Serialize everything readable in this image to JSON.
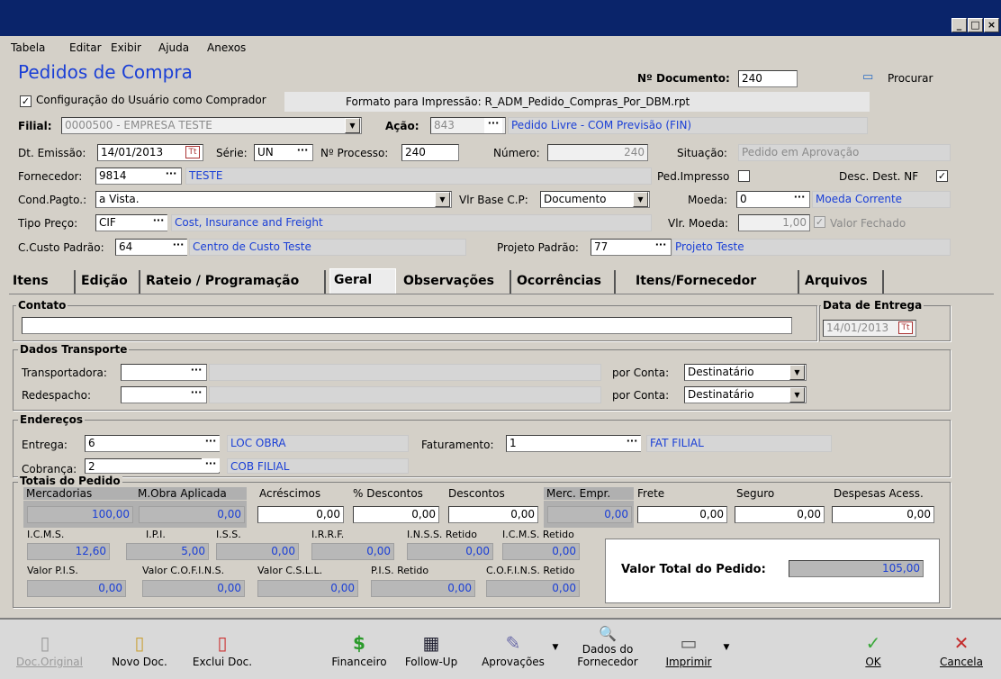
{
  "window": {
    "controls": [
      "_",
      "□",
      "×"
    ]
  },
  "menu": [
    "Tabela",
    "Editar",
    "Exibir",
    "Ajuda",
    "Anexos"
  ],
  "header": {
    "title": "Pedidos de Compra",
    "doc_label": "Nº Documento:",
    "doc_value": "240",
    "search_label": "Procurar"
  },
  "config": {
    "checkbox_label": "Configuração do Usuário como Comprador",
    "checked": true,
    "format_label": "Formato para Impressão: R_ADM_Pedido_Compras_Por_DBM.rpt"
  },
  "form": {
    "filial_label": "Filial:",
    "filial_value": "0000500 - EMPRESA TESTE",
    "acao_label": "Ação:",
    "acao_code": "843",
    "acao_desc": "Pedido Livre - COM Previsão (FIN)",
    "emissao_label": "Dt. Emissão:",
    "emissao_value": "14/01/2013",
    "serie_label": "Série:",
    "serie_value": "UN",
    "processo_label": "Nº Processo:",
    "processo_value": "240",
    "numero_label": "Número:",
    "numero_value": "240",
    "situacao_label": "Situação:",
    "situacao_value": "Pedido em Aprovação",
    "fornecedor_label": "Fornecedor:",
    "fornecedor_code": "9814",
    "fornecedor_name": "TESTE",
    "ped_impresso_label": "Ped.Impresso",
    "desc_dest_label": "Desc. Dest. NF",
    "cond_label": "Cond.Pagto.:",
    "cond_value": "a Vista.",
    "vlr_base_label": "Vlr Base C.P:",
    "vlr_base_value": "Documento",
    "moeda_label": "Moeda:",
    "moeda_code": "0",
    "moeda_desc": "Moeda Corrente",
    "tipo_preco_label": "Tipo Preço:",
    "tipo_preco_code": "CIF",
    "tipo_preco_desc": "Cost, Insurance and Freight",
    "vlr_moeda_label": "Vlr. Moeda:",
    "vlr_moeda_value": "1,00",
    "valor_fechado_label": "Valor Fechado",
    "ccusto_label": "C.Custo Padrão:",
    "ccusto_code": "64",
    "ccusto_desc": "Centro de Custo Teste",
    "projeto_label": "Projeto Padrão:",
    "projeto_code": "77",
    "projeto_desc": "Projeto Teste"
  },
  "tabs": [
    "Itens",
    "Edição",
    "Rateio / Programação",
    "Geral",
    "Observações",
    "Ocorrências",
    "Itens/Fornecedor",
    "Arquivos"
  ],
  "geral": {
    "contato_title": "Contato",
    "entrega_title": "Data de Entrega",
    "entrega_value": "14/01/2013",
    "transporte_title": "Dados Transporte",
    "transportadora_label": "Transportadora:",
    "redespacho_label": "Redespacho:",
    "por_conta_label": "por Conta:",
    "por_conta_1": "Destinatário",
    "por_conta_2": "Destinatário",
    "enderecos_title": "Endereços",
    "entrega_label": "Entrega:",
    "entrega_code": "6",
    "entrega_desc": "LOC OBRA",
    "faturamento_label": "Faturamento:",
    "faturamento_code": "1",
    "faturamento_desc": "FAT FILIAL",
    "cobranca_label": "Cobrança:",
    "cobranca_code": "2",
    "cobranca_desc": "COB FILIAL"
  },
  "totais": {
    "title": "Totais do Pedido",
    "row1_labels": [
      "Mercadorias",
      "M.Obra Aplicada",
      "Acréscimos",
      "% Descontos",
      "Descontos",
      "Merc. Empr.",
      "Frete",
      "Seguro",
      "Despesas Acess."
    ],
    "row1_values": [
      "100,00",
      "0,00",
      "0,00",
      "0,00",
      "0,00",
      "0,00",
      "0,00",
      "0,00",
      "0,00"
    ],
    "row2_labels": [
      "I.C.M.S.",
      "I.P.I.",
      "I.S.S.",
      "I.R.R.F.",
      "I.N.S.S. Retido",
      "I.C.M.S. Retido"
    ],
    "row2_values": [
      "12,60",
      "5,00",
      "0,00",
      "0,00",
      "0,00",
      "0,00"
    ],
    "row3_labels": [
      "Valor P.I.S.",
      "Valor C.O.F.I.N.S.",
      "Valor C.S.L.L.",
      "P.I.S. Retido",
      "C.O.F.I.N.S. Retido"
    ],
    "row3_values": [
      "0,00",
      "0,00",
      "0,00",
      "0,00",
      "0,00"
    ],
    "valor_total_label": "Valor Total do Pedido:",
    "valor_total_value": "105,00"
  },
  "toolbar": {
    "doc_original": "Doc.Original",
    "novo": "Novo Doc.",
    "exclui": "Exclui Doc.",
    "financeiro": "Financeiro",
    "followup": "Follow-Up",
    "aprovacoes": "Aprovações",
    "dados_fornecedor": "Dados do Fornecedor",
    "imprimir": "Imprimir",
    "ok": "OK",
    "cancela": "Cancela"
  }
}
